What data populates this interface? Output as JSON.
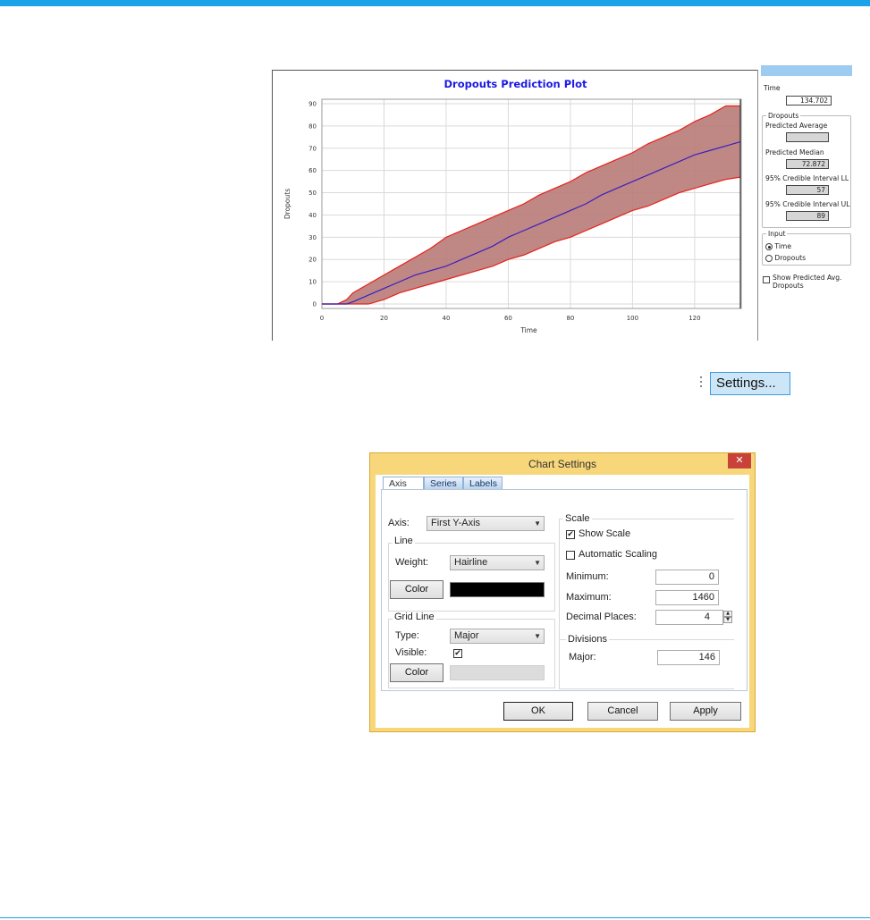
{
  "colors": {
    "accent_bar": "#1aa3e8",
    "band_fill": "#b87b78",
    "band_edge": "#e8201a",
    "series_line": "#3a1fc0",
    "plot_title": "#1a1ae6",
    "dialog_frame": "#f7d77a",
    "close_button": "#c8423a"
  },
  "chart_data": {
    "type": "area",
    "title": "Dropouts Prediction Plot",
    "xlabel": "Time",
    "ylabel": "Dropouts",
    "xlim": [
      0,
      135
    ],
    "ylim": [
      -2,
      92
    ],
    "xticks": [
      0,
      20,
      40,
      60,
      80,
      100,
      120
    ],
    "yticks": [
      0,
      10,
      20,
      30,
      40,
      50,
      60,
      70,
      80,
      90
    ],
    "grid": true,
    "x": [
      0,
      5,
      8,
      10,
      15,
      20,
      25,
      30,
      35,
      40,
      45,
      50,
      55,
      60,
      65,
      70,
      75,
      80,
      85,
      90,
      95,
      100,
      105,
      110,
      115,
      120,
      125,
      130,
      134.7
    ],
    "series": [
      {
        "name": "95% Credible Interval UL",
        "values": [
          0,
          0,
          2,
          5,
          9,
          13,
          17,
          21,
          25,
          30,
          33,
          36,
          39,
          42,
          45,
          49,
          52,
          55,
          59,
          62,
          65,
          68,
          72,
          75,
          78,
          82,
          85,
          89,
          89
        ]
      },
      {
        "name": "Predicted Median",
        "values": [
          0,
          0,
          0,
          1,
          4,
          7,
          10,
          13,
          15,
          17,
          20,
          23,
          26,
          30,
          33,
          36,
          39,
          42,
          45,
          49,
          52,
          55,
          58,
          61,
          64,
          67,
          69,
          71,
          72.9
        ]
      },
      {
        "name": "95% Credible Interval LL",
        "values": [
          0,
          0,
          0,
          0,
          0,
          2,
          5,
          7,
          9,
          11,
          13,
          15,
          17,
          20,
          22,
          25,
          28,
          30,
          33,
          36,
          39,
          42,
          44,
          47,
          50,
          52,
          54,
          56,
          57
        ]
      }
    ]
  },
  "side_panel": {
    "time_label": "Time",
    "time_value": "134.702",
    "dropouts_legend": "Dropouts",
    "predicted_average_label": "Predicted Average",
    "predicted_average_value": "",
    "predicted_median_label": "Predicted Median",
    "predicted_median_value": "72.872",
    "ll_label": "95% Credible Interval LL",
    "ll_value": "57",
    "ul_label": "95% Credible Interval UL",
    "ul_value": "89",
    "input_legend": "Input",
    "radio_time": "Time",
    "radio_dropouts": "Dropouts",
    "show_avg_label": "Show Predicted Avg. Dropouts"
  },
  "toolbar": {
    "settings_label": "Settings..."
  },
  "dialog": {
    "title": "Chart Settings",
    "close_glyph": "✕",
    "tabs": [
      "Axis",
      "Series",
      "Labels"
    ],
    "axis_label": "Axis:",
    "axis_value": "First Y-Axis",
    "line_group": "Line",
    "weight_label": "Weight:",
    "weight_value": "Hairline",
    "line_color_button": "Color",
    "line_color": "#000000",
    "gridline_group": "Grid Line",
    "type_label": "Type:",
    "type_value": "Major",
    "visible_label": "Visible:",
    "visible_check": "✔",
    "grid_color_button": "Color",
    "grid_color": "#dcdcdc",
    "scale_group": "Scale",
    "show_scale_label": "Show Scale",
    "show_scale_check": "✔",
    "auto_scaling_label": "Automatic Scaling",
    "minimum_label": "Minimum:",
    "minimum_value": "0",
    "maximum_label": "Maximum:",
    "maximum_value": "1460",
    "decimal_label": "Decimal Places:",
    "decimal_value": "4",
    "divisions_group": "Divisions",
    "major_label": "Major:",
    "major_value": "146",
    "ok_label": "OK",
    "cancel_label": "Cancel",
    "apply_label": "Apply"
  }
}
